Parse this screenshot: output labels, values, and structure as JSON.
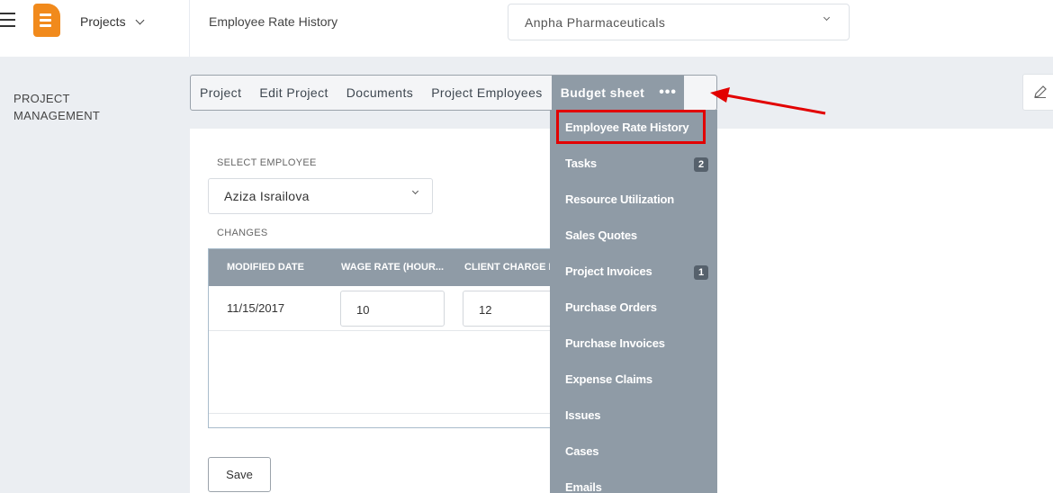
{
  "header": {
    "app_menu_label": "Projects",
    "page_title": "Employee Rate History",
    "company_selected": "Anpha Pharmaceuticals"
  },
  "sidebar": {
    "section_title_line1": "PROJECT",
    "section_title_line2": "MANAGEMENT"
  },
  "tabs": [
    {
      "label": "Project"
    },
    {
      "label": "Edit Project"
    },
    {
      "label": "Documents"
    },
    {
      "label": "Project Employees"
    },
    {
      "label": "Budget sheet"
    },
    {
      "label": "•••"
    }
  ],
  "form": {
    "select_employee_label": "SELECT EMPLOYEE",
    "employee_selected": "Aziza Israilova",
    "changes_label": "CHANGES"
  },
  "grid": {
    "columns": [
      "MODIFIED DATE",
      "WAGE RATE (HOUR...",
      "CLIENT CHARGE R"
    ],
    "rows": [
      {
        "modified_date": "11/15/2017",
        "wage_rate": "10",
        "client_charge": "12"
      }
    ]
  },
  "actions": {
    "save_label": "Save"
  },
  "dropdown": {
    "items": [
      {
        "label": "Employee Rate History",
        "badge": ""
      },
      {
        "label": "Tasks",
        "badge": "2"
      },
      {
        "label": "Resource Utilization",
        "badge": ""
      },
      {
        "label": "Sales Quotes",
        "badge": ""
      },
      {
        "label": "Project Invoices",
        "badge": "1"
      },
      {
        "label": "Purchase Orders",
        "badge": ""
      },
      {
        "label": "Purchase Invoices",
        "badge": ""
      },
      {
        "label": "Expense Claims",
        "badge": ""
      },
      {
        "label": "Issues",
        "badge": ""
      },
      {
        "label": "Cases",
        "badge": ""
      },
      {
        "label": "Emails",
        "badge": ""
      }
    ]
  },
  "colors": {
    "accent_orange": "#f18a1c",
    "tab_active_bg": "#8f9ba6",
    "annotation_red": "#e20000"
  },
  "icons": [
    "hamburger-icon",
    "app-logo-icon",
    "chevron-down-icon",
    "more-dots-icon",
    "pencil-icon",
    "annotation-arrow"
  ]
}
